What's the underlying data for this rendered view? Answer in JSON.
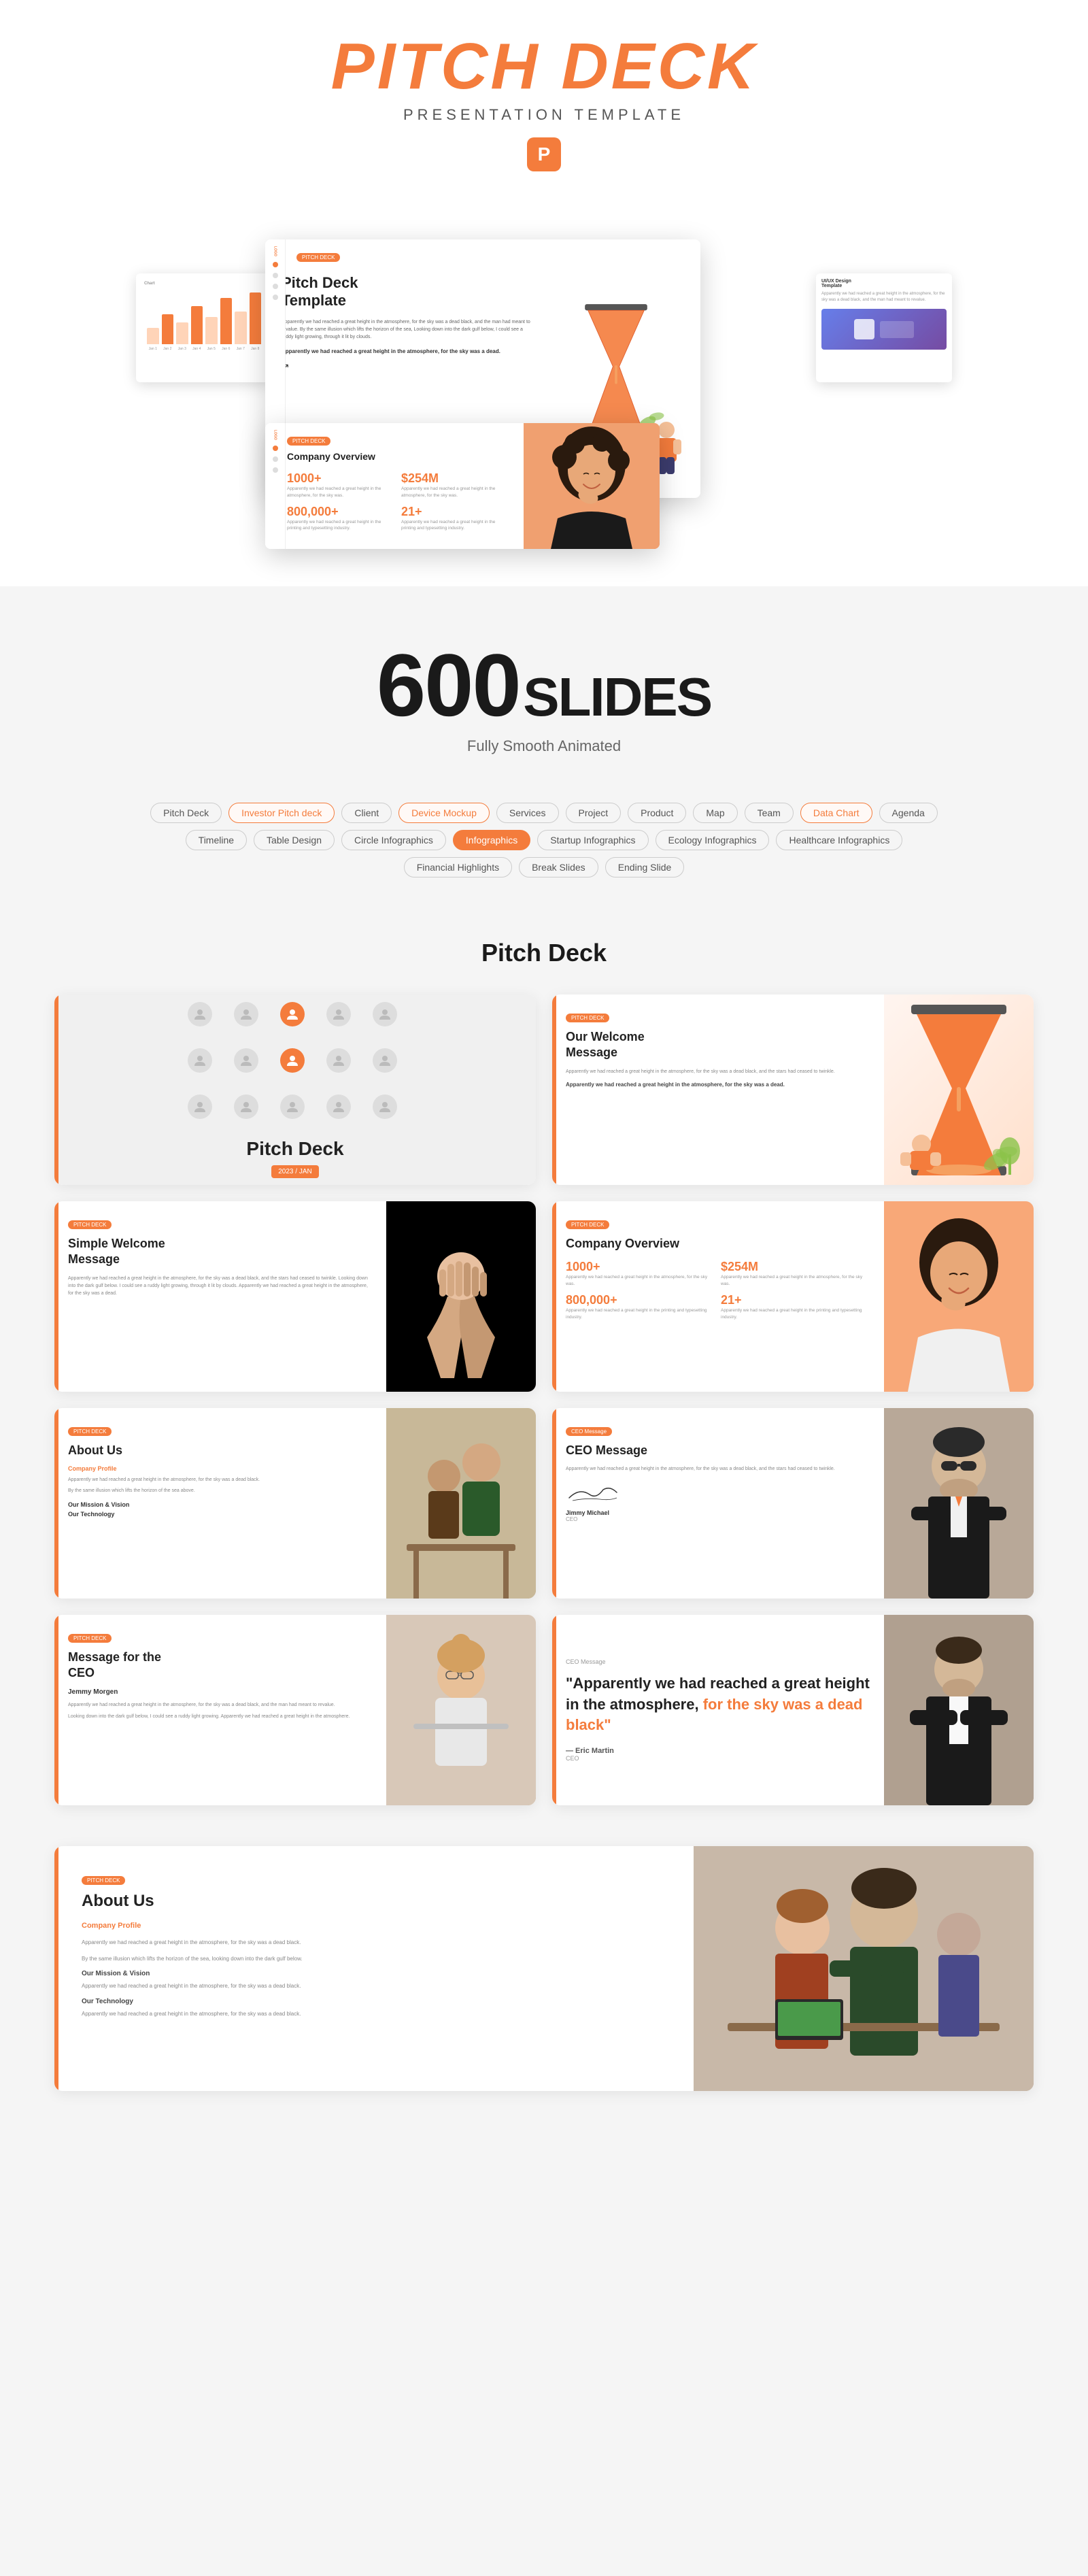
{
  "header": {
    "main_title": "PITCH DECK",
    "subtitle": "PRESENTATION TEMPLATE",
    "powerpoint_icon": "P"
  },
  "slides_count": {
    "number": "600",
    "label": "SLIDES",
    "description": "Fully Smooth Animated"
  },
  "tags": [
    {
      "label": "Pitch Deck",
      "active": false
    },
    {
      "label": "Investor Pitch deck",
      "active": true,
      "style": "active-orange"
    },
    {
      "label": "Client",
      "active": false
    },
    {
      "label": "Device Mockup",
      "active": true,
      "style": "active-orange"
    },
    {
      "label": "Services",
      "active": false
    },
    {
      "label": "Project",
      "active": false
    },
    {
      "label": "Product",
      "active": false
    },
    {
      "label": "Map",
      "active": false
    },
    {
      "label": "Team",
      "active": false
    },
    {
      "label": "Data Chart",
      "active": true,
      "style": "active-orange"
    },
    {
      "label": "Agenda",
      "active": false
    },
    {
      "label": "Timeline",
      "active": false
    },
    {
      "label": "Table Design",
      "active": false
    },
    {
      "label": "Circle Infographics",
      "active": false
    },
    {
      "label": "Infographics",
      "active": true,
      "style": "active-fill"
    },
    {
      "label": "Startup Infographics",
      "active": false
    },
    {
      "label": "Ecology Infographics",
      "active": false
    },
    {
      "label": "Healthcare Infographics",
      "active": false
    },
    {
      "label": "Financial Highlights",
      "active": false
    },
    {
      "label": "Break Slides",
      "active": false
    },
    {
      "label": "Ending Slide",
      "active": false
    }
  ],
  "pitch_deck_section": {
    "title": "Pitch Deck",
    "slides": [
      {
        "id": "pitch-deck-cover",
        "type": "cover",
        "title": "Pitch Deck",
        "date": "2023 / JAN"
      },
      {
        "id": "welcome-message",
        "type": "welcome",
        "tag": "PITCH DECK",
        "title": "Our Welcome\nMessage",
        "body": "Apparently we had reached a great height in the atmosphere, for the sky was a dead black, and the stars had ceased to twinkle.",
        "bold": "Apparently we had reached a great height in the atmosphere, for the sky was a dead."
      },
      {
        "id": "simple-welcome",
        "type": "simple-welcome",
        "tag": "PITCH DECK",
        "title": "Simple Welcome\nMessage",
        "body": "Apparently we had reached a great height in the atmosphere, for the sky was a dead black, and the stars had ceased to twinkle. Looking down into the dark gulf below. I could see a ruddy light growing, through it lit by clouds. Apparently we had reached a great height in the atmosphere, for the sky was a dead."
      },
      {
        "id": "company-overview",
        "type": "company-overview",
        "tag": "PITCH DECK",
        "title": "Company Overview",
        "stats": [
          {
            "num": "1000+",
            "desc": "Apparently we had reached a great height in the atmosphere, for the sky was."
          },
          {
            "num": "$254M",
            "desc": "Apparently we had reached a great height in the atmosphere, for the sky was."
          },
          {
            "num": "800,000+",
            "desc": "Apparently we had reached a great height in the printing and typesetting industry."
          },
          {
            "num": "21+",
            "desc": "Apparently we had reached a great height in the printing and typesetting industry."
          }
        ]
      },
      {
        "id": "about-us",
        "type": "about-us",
        "tag": "PITCH DECK",
        "title": "About Us",
        "profile": "Company Profile",
        "body1": "Apparently we had reached a great height in the atmosphere, for the sky was a dead black.",
        "body2": "By the same illusion which lifts the horizon of the sea above.",
        "mission": "Our Mission & Vision",
        "technology": "Our Technology"
      },
      {
        "id": "ceo-message",
        "type": "ceo-message",
        "tag": "CEO Message",
        "title": "CEO Message",
        "body": "Apparently we had reached a great height in the atmosphere, for the sky was a dead black, and the stars had ceased to twinkle.",
        "author_name": "Jimmy Michael",
        "author_title": "CEO"
      },
      {
        "id": "message-for-ceo",
        "type": "message-for-ceo",
        "tag": "PITCH DECK",
        "title": "Message for the CEO",
        "author_name": "Jemmy Morgen",
        "body": "Apparently we had reached a great height in the atmosphere, for the sky was a dead black, and the man had meant to revalue."
      },
      {
        "id": "ceo-quote",
        "type": "ceo-quote",
        "tag": "CEO Message",
        "quote_start": "\"Apparently we had reached a great height in the atmosphere,",
        "quote_orange": "for the sky was a dead black\"",
        "author_name": "— Eric Martin",
        "author_title": "CEO"
      }
    ]
  },
  "about_us_section": {
    "title": "About Us",
    "profile_label": "Company Profile",
    "body1": "Apparently we had reached a great height in the atmosphere, for the sky was a dead black.",
    "body2": "By the same illusion which lifts the horizon of the sea, looking down into the dark gulf below.",
    "mission_label": "Our Mission & Vision",
    "technology_label": "Our Technology"
  },
  "slide_labels": {
    "investor_pitch_deck": "Investor Pitch deck",
    "team": "Team",
    "product": "Product",
    "services": "Services",
    "financial_highlights": "Financial Highlights"
  },
  "main_slide": {
    "badge": "PITCH DECK",
    "title": "Pitch Deck\nTemplate",
    "body": "Apparently we had reached a great height in the atmosphere, for the sky was a dead black, and the man had meant to revalue. By the same illusion which lifts the horizon of the sea, Looking down into the dark gulf below, I could see a ruddy light growing, through it lit by clouds.",
    "bold": "Apparently we had reached a great height in the atmosphere, for the sky was a dead."
  },
  "company_overview_preview": {
    "title": "Company Overview",
    "stats": [
      {
        "num": "1000+"
      },
      {
        "num": "$254M"
      },
      {
        "num": "800,000+"
      },
      {
        "num": "21+"
      }
    ]
  }
}
